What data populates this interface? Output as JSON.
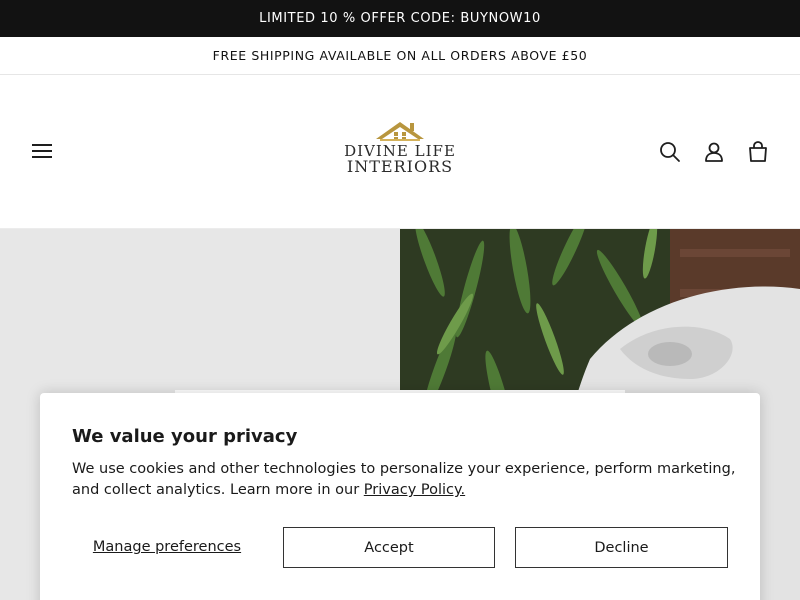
{
  "announcement": {
    "top_text": "LIMITED 10 % OFFER CODE: BUYNOW10",
    "second_text": "FREE SHIPPING AVAILABLE ON ALL ORDERS ABOVE £50"
  },
  "header": {
    "logo_line1": "DIVINE LIFE",
    "logo_line2": "INTERIORS",
    "icons": [
      "menu-icon",
      "search-icon",
      "account-icon",
      "cart-icon"
    ]
  },
  "cookie_banner": {
    "title": "We value your privacy",
    "body": "We use cookies and other technologies to personalize your experience, perform marketing, and collect analytics. Learn more in our ",
    "privacy_link": "Privacy Policy.",
    "manage_label": "Manage preferences",
    "accept_label": "Accept",
    "decline_label": "Decline"
  },
  "colors": {
    "announcement_bg": "#121212",
    "logo_gold": "#b8963e",
    "hero_left_bg": "#e7e7e7"
  }
}
